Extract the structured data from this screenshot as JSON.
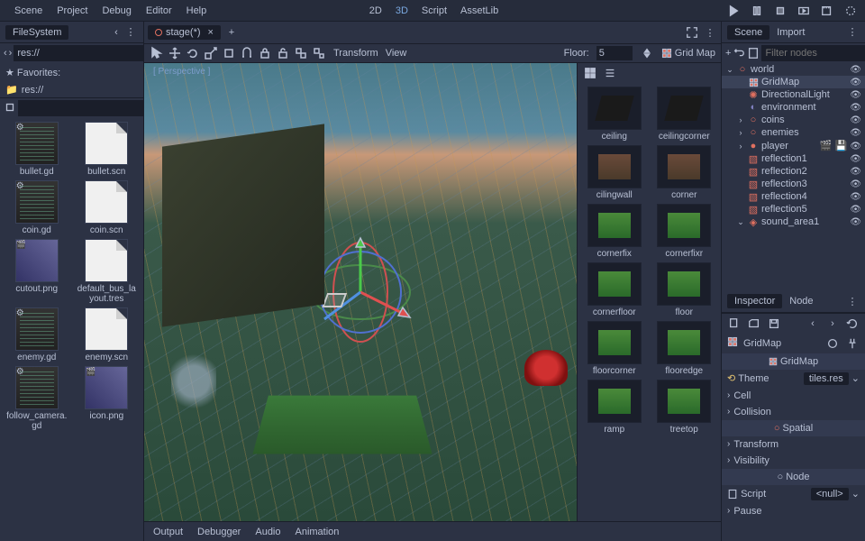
{
  "menubar": [
    "Scene",
    "Project",
    "Debug",
    "Editor",
    "Help"
  ],
  "workspaces": {
    "2d": "2D",
    "3d": "3D",
    "script": "Script",
    "assetlib": "AssetLib"
  },
  "filesystem": {
    "title": "FileSystem",
    "path": "res://",
    "favorites_label": "Favorites:",
    "root_label": "res://",
    "files": [
      {
        "name": "bullet.gd",
        "type": "code"
      },
      {
        "name": "bullet.scn",
        "type": "page"
      },
      {
        "name": "coin.gd",
        "type": "code"
      },
      {
        "name": "coin.scn",
        "type": "page"
      },
      {
        "name": "cutout.png",
        "type": "img"
      },
      {
        "name": "default_bus_layout.tres",
        "type": "page"
      },
      {
        "name": "enemy.gd",
        "type": "code"
      },
      {
        "name": "enemy.scn",
        "type": "page"
      },
      {
        "name": "follow_camera.gd",
        "type": "code"
      },
      {
        "name": "icon.png",
        "type": "img"
      }
    ]
  },
  "scene_tab": {
    "name": "stage(*)"
  },
  "viewport_toolbar": {
    "transform": "Transform",
    "view": "View",
    "floor_label": "Floor:",
    "floor_value": "5",
    "gridmap_label": "Grid Map"
  },
  "viewport": {
    "perspective_label": "[ Perspective ]"
  },
  "palette": {
    "items": [
      {
        "name": "ceiling",
        "kind": "dark"
      },
      {
        "name": "ceilingcorner",
        "kind": "dark"
      },
      {
        "name": "cilingwall",
        "kind": "brown"
      },
      {
        "name": "corner",
        "kind": "brown"
      },
      {
        "name": "cornerfix",
        "kind": "grass"
      },
      {
        "name": "cornerfixr",
        "kind": "grass"
      },
      {
        "name": "cornerfloor",
        "kind": "grass"
      },
      {
        "name": "floor",
        "kind": "grass"
      },
      {
        "name": "floorcorner",
        "kind": "grass"
      },
      {
        "name": "flooredge",
        "kind": "grass"
      },
      {
        "name": "ramp",
        "kind": "grass"
      },
      {
        "name": "treetop",
        "kind": "grass"
      }
    ]
  },
  "bottom_tabs": [
    "Output",
    "Debugger",
    "Audio",
    "Animation"
  ],
  "right_dock": {
    "scene_tab": "Scene",
    "import_tab": "Import",
    "filter_placeholder": "Filter nodes",
    "tree": [
      {
        "name": "world",
        "icon": "spatial",
        "depth": 0,
        "expand": "⌄"
      },
      {
        "name": "GridMap",
        "icon": "gridmap",
        "depth": 1,
        "selected": true
      },
      {
        "name": "DirectionalLight",
        "icon": "light",
        "depth": 1
      },
      {
        "name": "environment",
        "icon": "env",
        "depth": 1
      },
      {
        "name": "coins",
        "icon": "spatial",
        "depth": 1,
        "expand": "›"
      },
      {
        "name": "enemies",
        "icon": "spatial",
        "depth": 1,
        "expand": "›"
      },
      {
        "name": "player",
        "icon": "player",
        "depth": 1,
        "expand": "›",
        "extras": true
      },
      {
        "name": "reflection1",
        "icon": "reflect",
        "depth": 1
      },
      {
        "name": "reflection2",
        "icon": "reflect",
        "depth": 1
      },
      {
        "name": "reflection3",
        "icon": "reflect",
        "depth": 1
      },
      {
        "name": "reflection4",
        "icon": "reflect",
        "depth": 1
      },
      {
        "name": "reflection5",
        "icon": "reflect",
        "depth": 1
      },
      {
        "name": "sound_area1",
        "icon": "area",
        "depth": 1,
        "expand": "⌄"
      }
    ]
  },
  "inspector": {
    "tab": "Inspector",
    "node_tab": "Node",
    "obj_name": "GridMap",
    "class_header": "GridMap",
    "theme_label": "Theme",
    "theme_value": "tiles.res",
    "sections": [
      "Cell",
      "Collision"
    ],
    "spatial_header": "Spatial",
    "spatial_sections": [
      "Transform",
      "Visibility"
    ],
    "node_header": "Node",
    "script_label": "Script",
    "script_value": "<null>",
    "pause_label": "Pause"
  }
}
